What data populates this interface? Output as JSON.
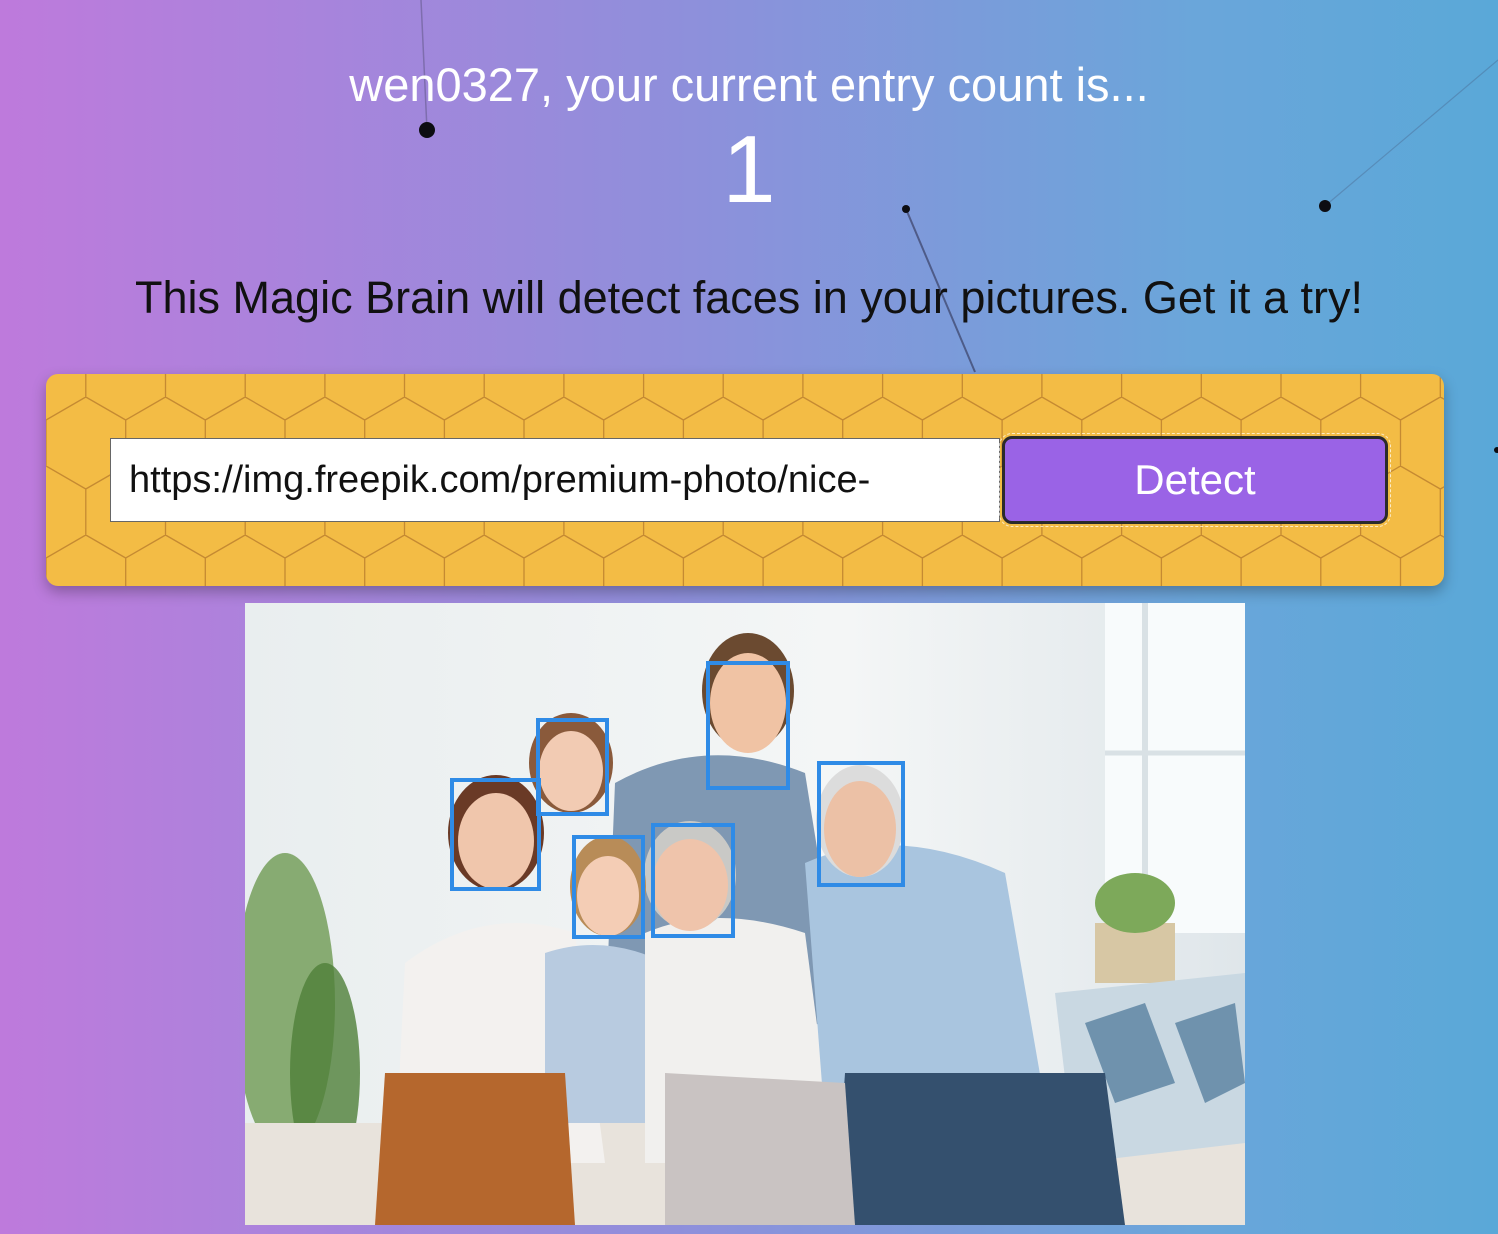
{
  "header": {
    "greeting": "wen0327, your current entry count is...",
    "entry_count": "1"
  },
  "tagline": "This Magic Brain will detect faces in your pictures. Get it a try!",
  "form": {
    "url_value": "https://img.freepik.com/premium-photo/nice-",
    "detect_label": "Detect"
  },
  "colors": {
    "panel": "#f3bc45",
    "button": "#9a63e6",
    "face_box": "#2f8be6"
  },
  "result": {
    "face_count": 6
  }
}
